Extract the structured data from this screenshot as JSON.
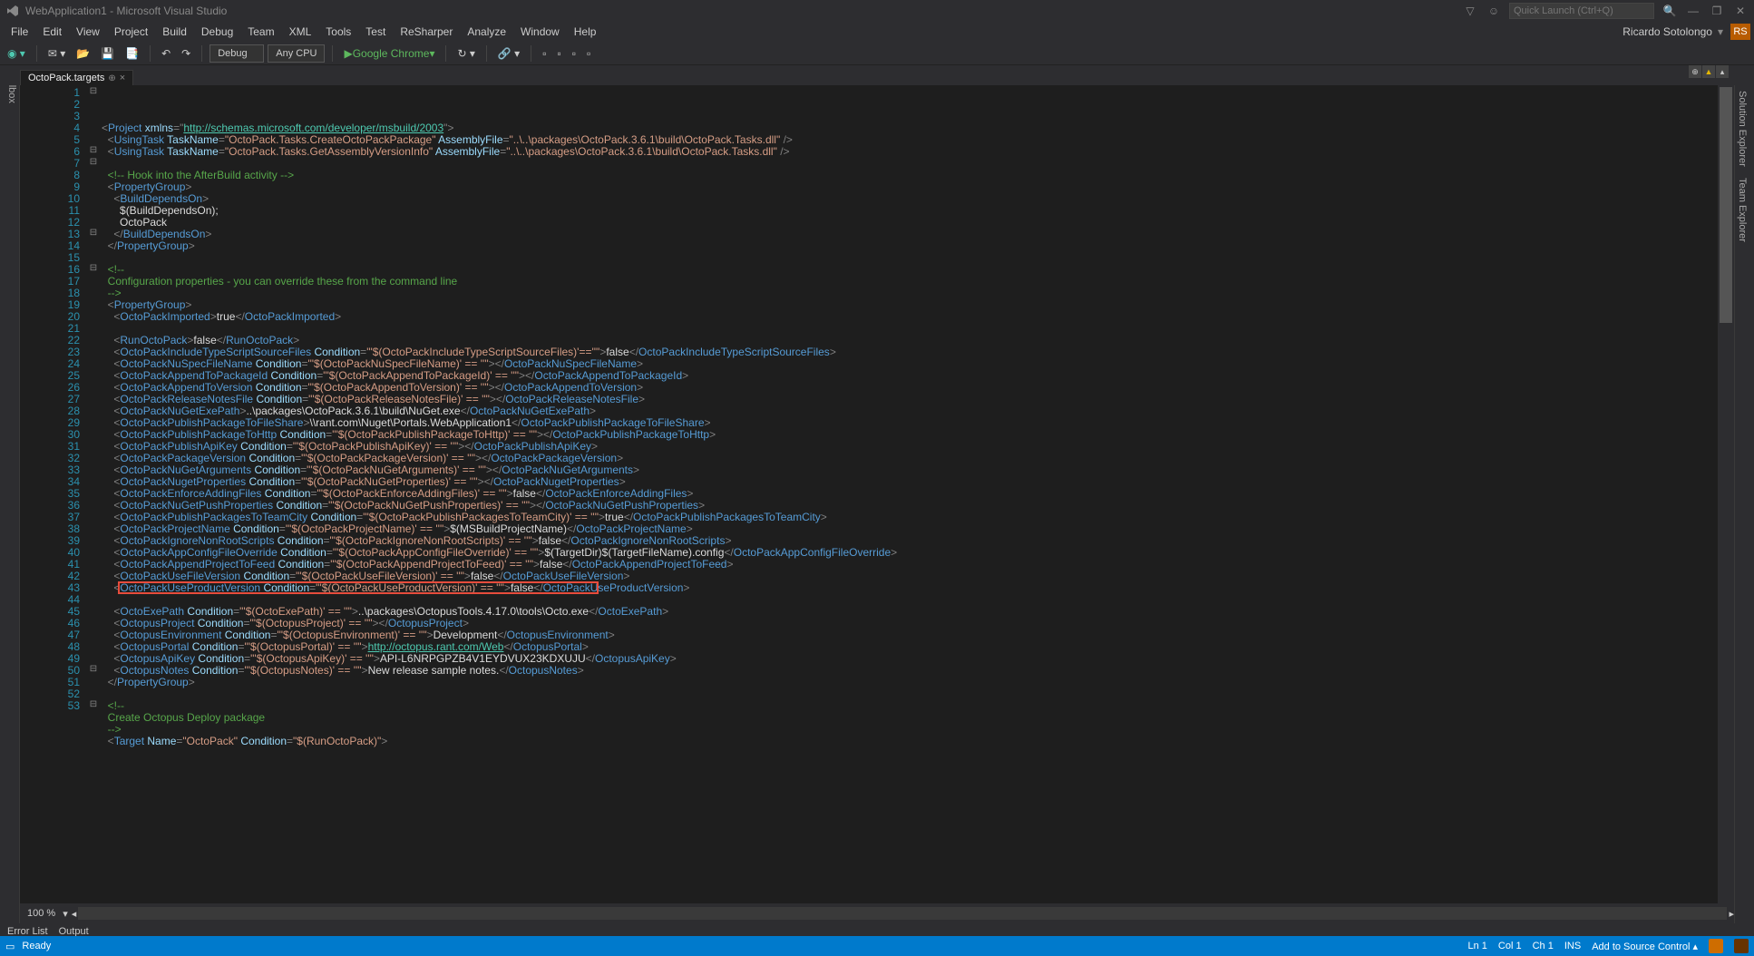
{
  "title": "WebApplication1 - Microsoft Visual Studio",
  "quick_launch_placeholder": "Quick Launch (Ctrl+Q)",
  "menu": [
    "File",
    "Edit",
    "View",
    "Project",
    "Build",
    "Debug",
    "Team",
    "XML",
    "Tools",
    "Test",
    "ReSharper",
    "Analyze",
    "Window",
    "Help"
  ],
  "user_name": "Ricardo Sotolongo",
  "user_initials": "RS",
  "toolbar": {
    "config": "Debug",
    "platform": "Any CPU",
    "run_label": "Google Chrome"
  },
  "left_rail": "Toolbox",
  "right_rails": [
    "Solution Explorer",
    "Team Explorer"
  ],
  "tab": {
    "label": "OctoPack.targets",
    "pin": "⊕",
    "close": "×"
  },
  "zoom": "100 %",
  "output_tabs": [
    "Error List",
    "Output"
  ],
  "status": {
    "ready": "Ready",
    "ln": "Ln 1",
    "col": "Col 1",
    "ch": "Ch 1",
    "ins": "INS",
    "src": "Add to Source Control"
  },
  "code_lines": [
    {
      "n": 1,
      "g": "⊟",
      "html": "<span class='c-punc'>&lt;</span><span class='c-elem'>Project</span> <span class='c-attr'>xmlns</span><span class='c-punc'>=&quot;</span><span class='c-link'>http://schemas.microsoft.com/developer/msbuild/2003</span><span class='c-punc'>&quot;&gt;</span>"
    },
    {
      "n": 2,
      "g": "",
      "html": "  <span class='c-punc'>&lt;</span><span class='c-elem'>UsingTask</span> <span class='c-attr'>TaskName</span><span class='c-punc'>=</span><span class='c-str'>&quot;OctoPack.Tasks.CreateOctoPackPackage&quot;</span> <span class='c-attr'>AssemblyFile</span><span class='c-punc'>=</span><span class='c-str'>&quot;..\\..\\packages\\OctoPack.3.6.1\\build\\OctoPack.Tasks.dll&quot;</span> <span class='c-punc'>/&gt;</span>"
    },
    {
      "n": 3,
      "g": "",
      "html": "  <span class='c-punc'>&lt;</span><span class='c-elem'>UsingTask</span> <span class='c-attr'>TaskName</span><span class='c-punc'>=</span><span class='c-str'>&quot;OctoPack.Tasks.GetAssemblyVersionInfo&quot;</span> <span class='c-attr'>AssemblyFile</span><span class='c-punc'>=</span><span class='c-str'>&quot;..\\..\\packages\\OctoPack.3.6.1\\build\\OctoPack.Tasks.dll&quot;</span> <span class='c-punc'>/&gt;</span>"
    },
    {
      "n": 4,
      "g": "",
      "html": ""
    },
    {
      "n": 5,
      "g": "",
      "html": "  <span class='c-cmt'>&lt;!-- Hook into the AfterBuild activity --&gt;</span>"
    },
    {
      "n": 6,
      "g": "⊟",
      "html": "  <span class='c-punc'>&lt;</span><span class='c-elem'>PropertyGroup</span><span class='c-punc'>&gt;</span>"
    },
    {
      "n": 7,
      "g": "⊟",
      "html": "    <span class='c-punc'>&lt;</span><span class='c-elem'>BuildDependsOn</span><span class='c-punc'>&gt;</span>"
    },
    {
      "n": 8,
      "g": "",
      "html": "      <span class='c-txt'>$(BuildDependsOn);</span>"
    },
    {
      "n": 9,
      "g": "",
      "html": "      <span class='c-txt'>OctoPack</span>"
    },
    {
      "n": 10,
      "g": "",
      "html": "    <span class='c-punc'>&lt;/</span><span class='c-elem'>BuildDependsOn</span><span class='c-punc'>&gt;</span>"
    },
    {
      "n": 11,
      "g": "",
      "html": "  <span class='c-punc'>&lt;/</span><span class='c-elem'>PropertyGroup</span><span class='c-punc'>&gt;</span>"
    },
    {
      "n": 12,
      "g": "",
      "html": ""
    },
    {
      "n": 13,
      "g": "⊟",
      "html": "  <span class='c-cmt'>&lt;!--</span>"
    },
    {
      "n": 14,
      "g": "",
      "html": "  <span class='c-cmt'>Configuration properties - you can override these from the command line</span>"
    },
    {
      "n": 15,
      "g": "",
      "html": "  <span class='c-cmt'>--&gt;</span>"
    },
    {
      "n": 16,
      "g": "⊟",
      "html": "  <span class='c-punc'>&lt;</span><span class='c-elem'>PropertyGroup</span><span class='c-punc'>&gt;</span>"
    },
    {
      "n": 17,
      "g": "",
      "html": "    <span class='c-punc'>&lt;</span><span class='c-elem'>OctoPackImported</span><span class='c-punc'>&gt;</span><span class='c-txt'>true</span><span class='c-punc'>&lt;/</span><span class='c-elem'>OctoPackImported</span><span class='c-punc'>&gt;</span>"
    },
    {
      "n": 18,
      "g": "",
      "html": ""
    },
    {
      "n": 19,
      "g": "",
      "html": "    <span class='c-punc'>&lt;</span><span class='c-elem'>RunOctoPack</span><span class='c-punc'>&gt;</span><span class='c-txt'>false</span><span class='c-punc'>&lt;/</span><span class='c-elem'>RunOctoPack</span><span class='c-punc'>&gt;</span>"
    },
    {
      "n": 20,
      "g": "",
      "html": "    <span class='c-punc'>&lt;</span><span class='c-elem'>OctoPackIncludeTypeScriptSourceFiles</span> <span class='c-attr'>Condition</span><span class='c-punc'>=</span><span class='c-str'>&quot;'$(OctoPackIncludeTypeScriptSourceFiles)'==''&quot;</span><span class='c-punc'>&gt;</span><span class='c-txt'>false</span><span class='c-punc'>&lt;/</span><span class='c-elem'>OctoPackIncludeTypeScriptSourceFiles</span><span class='c-punc'>&gt;</span>"
    },
    {
      "n": 21,
      "g": "",
      "html": "    <span class='c-punc'>&lt;</span><span class='c-elem'>OctoPackNuSpecFileName</span> <span class='c-attr'>Condition</span><span class='c-punc'>=</span><span class='c-str'>&quot;'$(OctoPackNuSpecFileName)' == ''&quot;</span><span class='c-punc'>&gt;&lt;/</span><span class='c-elem'>OctoPackNuSpecFileName</span><span class='c-punc'>&gt;</span>"
    },
    {
      "n": 22,
      "g": "",
      "html": "    <span class='c-punc'>&lt;</span><span class='c-elem'>OctoPackAppendToPackageId</span> <span class='c-attr'>Condition</span><span class='c-punc'>=</span><span class='c-str'>&quot;'$(OctoPackAppendToPackageId)' == ''&quot;</span><span class='c-punc'>&gt;&lt;/</span><span class='c-elem'>OctoPackAppendToPackageId</span><span class='c-punc'>&gt;</span>"
    },
    {
      "n": 23,
      "g": "",
      "html": "    <span class='c-punc'>&lt;</span><span class='c-elem'>OctoPackAppendToVersion</span> <span class='c-attr'>Condition</span><span class='c-punc'>=</span><span class='c-str'>&quot;'$(OctoPackAppendToVersion)' == ''&quot;</span><span class='c-punc'>&gt;&lt;/</span><span class='c-elem'>OctoPackAppendToVersion</span><span class='c-punc'>&gt;</span>"
    },
    {
      "n": 24,
      "g": "",
      "html": "    <span class='c-punc'>&lt;</span><span class='c-elem'>OctoPackReleaseNotesFile</span> <span class='c-attr'>Condition</span><span class='c-punc'>=</span><span class='c-str'>&quot;'$(OctoPackReleaseNotesFile)' == ''&quot;</span><span class='c-punc'>&gt;&lt;/</span><span class='c-elem'>OctoPackReleaseNotesFile</span><span class='c-punc'>&gt;</span>"
    },
    {
      "n": 25,
      "g": "",
      "html": "    <span class='c-punc'>&lt;</span><span class='c-elem'>OctoPackNuGetExePath</span><span class='c-punc'>&gt;</span><span class='c-txt'>..\\packages\\OctoPack.3.6.1\\build\\NuGet.exe</span><span class='c-punc'>&lt;/</span><span class='c-elem'>OctoPackNuGetExePath</span><span class='c-punc'>&gt;</span>"
    },
    {
      "n": 26,
      "g": "",
      "html": "    <span class='c-punc'>&lt;</span><span class='c-elem'>OctoPackPublishPackageToFileShare</span><span class='c-punc'>&gt;</span><span class='c-txt'>\\\\rant.com\\Nuget\\Portals.WebApplication1</span><span class='c-punc'>&lt;/</span><span class='c-elem'>OctoPackPublishPackageToFileShare</span><span class='c-punc'>&gt;</span>"
    },
    {
      "n": 27,
      "g": "",
      "html": "    <span class='c-punc'>&lt;</span><span class='c-elem'>OctoPackPublishPackageToHttp</span> <span class='c-attr'>Condition</span><span class='c-punc'>=</span><span class='c-str'>&quot;'$(OctoPackPublishPackageToHttp)' == ''&quot;</span><span class='c-punc'>&gt;&lt;/</span><span class='c-elem'>OctoPackPublishPackageToHttp</span><span class='c-punc'>&gt;</span>"
    },
    {
      "n": 28,
      "g": "",
      "html": "    <span class='c-punc'>&lt;</span><span class='c-elem'>OctoPackPublishApiKey</span> <span class='c-attr'>Condition</span><span class='c-punc'>=</span><span class='c-str'>&quot;'$(OctoPackPublishApiKey)' == ''&quot;</span><span class='c-punc'>&gt;&lt;/</span><span class='c-elem'>OctoPackPublishApiKey</span><span class='c-punc'>&gt;</span>"
    },
    {
      "n": 29,
      "g": "",
      "html": "    <span class='c-punc'>&lt;</span><span class='c-elem'>OctoPackPackageVersion</span> <span class='c-attr'>Condition</span><span class='c-punc'>=</span><span class='c-str'>&quot;'$(OctoPackPackageVersion)' == ''&quot;</span><span class='c-punc'>&gt;&lt;/</span><span class='c-elem'>OctoPackPackageVersion</span><span class='c-punc'>&gt;</span>"
    },
    {
      "n": 30,
      "g": "",
      "html": "    <span class='c-punc'>&lt;</span><span class='c-elem'>OctoPackNuGetArguments</span> <span class='c-attr'>Condition</span><span class='c-punc'>=</span><span class='c-str'>&quot;'$(OctoPackNuGetArguments)' == ''&quot;</span><span class='c-punc'>&gt;&lt;/</span><span class='c-elem'>OctoPackNuGetArguments</span><span class='c-punc'>&gt;</span>"
    },
    {
      "n": 31,
      "g": "",
      "html": "    <span class='c-punc'>&lt;</span><span class='c-elem'>OctoPackNugetProperties</span> <span class='c-attr'>Condition</span><span class='c-punc'>=</span><span class='c-str'>&quot;'$(OctoPackNuGetProperties)' == ''&quot;</span><span class='c-punc'>&gt;&lt;/</span><span class='c-elem'>OctoPackNugetProperties</span><span class='c-punc'>&gt;</span>"
    },
    {
      "n": 32,
      "g": "",
      "html": "    <span class='c-punc'>&lt;</span><span class='c-elem'>OctoPackEnforceAddingFiles</span> <span class='c-attr'>Condition</span><span class='c-punc'>=</span><span class='c-str'>&quot;'$(OctoPackEnforceAddingFiles)' == ''&quot;</span><span class='c-punc'>&gt;</span><span class='c-txt'>false</span><span class='c-punc'>&lt;/</span><span class='c-elem'>OctoPackEnforceAddingFiles</span><span class='c-punc'>&gt;</span>"
    },
    {
      "n": 33,
      "g": "",
      "html": "    <span class='c-punc'>&lt;</span><span class='c-elem'>OctoPackNuGetPushProperties</span> <span class='c-attr'>Condition</span><span class='c-punc'>=</span><span class='c-str'>&quot;'$(OctoPackNuGetPushProperties)' == ''&quot;</span><span class='c-punc'>&gt;&lt;/</span><span class='c-elem'>OctoPackNuGetPushProperties</span><span class='c-punc'>&gt;</span>"
    },
    {
      "n": 34,
      "g": "",
      "html": "    <span class='c-punc'>&lt;</span><span class='c-elem'>OctoPackPublishPackagesToTeamCity</span> <span class='c-attr'>Condition</span><span class='c-punc'>=</span><span class='c-str'>&quot;'$(OctoPackPublishPackagesToTeamCity)' == ''&quot;</span><span class='c-punc'>&gt;</span><span class='c-txt'>true</span><span class='c-punc'>&lt;/</span><span class='c-elem'>OctoPackPublishPackagesToTeamCity</span><span class='c-punc'>&gt;</span>"
    },
    {
      "n": 35,
      "g": "",
      "html": "    <span class='c-punc'>&lt;</span><span class='c-elem'>OctoPackProjectName</span> <span class='c-attr'>Condition</span><span class='c-punc'>=</span><span class='c-str'>&quot;'$(OctoPackProjectName)' == ''&quot;</span><span class='c-punc'>&gt;</span><span class='c-txt'>$(MSBuildProjectName)</span><span class='c-punc'>&lt;/</span><span class='c-elem'>OctoPackProjectName</span><span class='c-punc'>&gt;</span>"
    },
    {
      "n": 36,
      "g": "",
      "html": "    <span class='c-punc'>&lt;</span><span class='c-elem'>OctoPackIgnoreNonRootScripts</span> <span class='c-attr'>Condition</span><span class='c-punc'>=</span><span class='c-str'>&quot;'$(OctoPackIgnoreNonRootScripts)' == ''&quot;</span><span class='c-punc'>&gt;</span><span class='c-txt'>false</span><span class='c-punc'>&lt;/</span><span class='c-elem'>OctoPackIgnoreNonRootScripts</span><span class='c-punc'>&gt;</span>"
    },
    {
      "n": 37,
      "g": "",
      "html": "    <span class='c-punc'>&lt;</span><span class='c-elem'>OctoPackAppConfigFileOverride</span> <span class='c-attr'>Condition</span><span class='c-punc'>=</span><span class='c-str'>&quot;'$(OctoPackAppConfigFileOverride)' == ''&quot;</span><span class='c-punc'>&gt;</span><span class='c-txt'>$(TargetDir)$(TargetFileName).config</span><span class='c-punc'>&lt;/</span><span class='c-elem'>OctoPackAppConfigFileOverride</span><span class='c-punc'>&gt;</span>"
    },
    {
      "n": 38,
      "g": "",
      "html": "    <span class='c-punc'>&lt;</span><span class='c-elem'>OctoPackAppendProjectToFeed</span> <span class='c-attr'>Condition</span><span class='c-punc'>=</span><span class='c-str'>&quot;'$(OctoPackAppendProjectToFeed)' == ''&quot;</span><span class='c-punc'>&gt;</span><span class='c-txt'>false</span><span class='c-punc'>&lt;/</span><span class='c-elem'>OctoPackAppendProjectToFeed</span><span class='c-punc'>&gt;</span>"
    },
    {
      "n": 39,
      "g": "",
      "html": "    <span class='c-punc'>&lt;</span><span class='c-elem'>OctoPackUseFileVersion</span> <span class='c-attr'>Condition</span><span class='c-punc'>=</span><span class='c-str'>&quot;'$(OctoPackUseFileVersion)' == ''&quot;</span><span class='c-punc'>&gt;</span><span class='c-txt'>false</span><span class='c-punc'>&lt;/</span><span class='c-elem'>OctoPackUseFileVersion</span><span class='c-punc'>&gt;</span>"
    },
    {
      "n": 40,
      "g": "",
      "html": "    <span class='c-punc'>&lt;</span><span class='c-elem'>OctoPackUseProductVersion</span> <span class='c-attr'>Condition</span><span class='c-punc'>=</span><span class='c-str'>&quot;'$(OctoPackUseProductVersion)' == ''&quot;</span><span class='c-punc'>&gt;</span><span class='c-txt'>false</span><span class='c-punc'>&lt;/</span><span class='c-elem'>OctoPackUseProductVersion</span><span class='c-punc'>&gt;</span>"
    },
    {
      "n": 41,
      "g": "",
      "html": ""
    },
    {
      "n": 42,
      "g": "",
      "html": "    <span class='c-punc'>&lt;</span><span class='c-elem'>OctoExePath</span> <span class='c-attr'>Condition</span><span class='c-punc'>=</span><span class='c-str'>&quot;'$(OctoExePath)' == ''&quot;</span><span class='c-punc'>&gt;</span><span class='c-txt'>..\\packages\\OctopusTools.4.17.0\\tools\\Octo.exe</span><span class='c-punc'>&lt;/</span><span class='c-elem'>OctoExePath</span><span class='c-punc'>&gt;</span>"
    },
    {
      "n": 43,
      "g": "",
      "html": "    <span class='c-punc'>&lt;</span><span class='c-elem'>OctopusProject</span> <span class='c-attr'>Condition</span><span class='c-punc'>=</span><span class='c-str'>&quot;'$(OctopusProject)' == ''&quot;</span><span class='c-punc'>&gt;&lt;/</span><span class='c-elem'>OctopusProject</span><span class='c-punc'>&gt;</span>"
    },
    {
      "n": 44,
      "g": "",
      "html": "    <span class='c-punc'>&lt;</span><span class='c-elem'>OctopusEnvironment</span> <span class='c-attr'>Condition</span><span class='c-punc'>=</span><span class='c-str'>&quot;'$(OctopusEnvironment)' == ''&quot;</span><span class='c-punc'>&gt;</span><span class='c-txt'>Development</span><span class='c-punc'>&lt;/</span><span class='c-elem'>OctopusEnvironment</span><span class='c-punc'>&gt;</span>"
    },
    {
      "n": 45,
      "g": "",
      "html": "    <span class='c-punc'>&lt;</span><span class='c-elem'>OctopusPortal</span> <span class='c-attr'>Condition</span><span class='c-punc'>=</span><span class='c-str'>&quot;'$(OctopusPortal)' == ''&quot;</span><span class='c-punc'>&gt;</span><span class='c-link'>http://octopus.rant.com/Web</span><span class='c-punc'>&lt;/</span><span class='c-elem'>OctopusPortal</span><span class='c-punc'>&gt;</span>"
    },
    {
      "n": 46,
      "g": "",
      "html": "    <span class='c-punc'>&lt;</span><span class='c-elem'>OctopusApiKey</span> <span class='c-attr'>Condition</span><span class='c-punc'>=</span><span class='c-str'>&quot;'$(OctopusApiKey)' == ''&quot;</span><span class='c-punc'>&gt;</span><span class='c-txt'>API-L6NRPGPZB4V1EYDVUX23KDXUJU</span><span class='c-punc'>&lt;/</span><span class='c-elem'>OctopusApiKey</span><span class='c-punc'>&gt;</span>"
    },
    {
      "n": 47,
      "g": "",
      "html": "    <span class='c-punc'>&lt;</span><span class='c-elem'>OctopusNotes</span> <span class='c-attr'>Condition</span><span class='c-punc'>=</span><span class='c-str'>&quot;'$(OctopusNotes)' == ''&quot;</span><span class='c-punc'>&gt;</span><span class='c-txt'>New release sample notes.</span><span class='c-punc'>&lt;/</span><span class='c-elem'>OctopusNotes</span><span class='c-punc'>&gt;</span>"
    },
    {
      "n": 48,
      "g": "",
      "html": "  <span class='c-punc'>&lt;/</span><span class='c-elem'>PropertyGroup</span><span class='c-punc'>&gt;</span>"
    },
    {
      "n": 49,
      "g": "",
      "html": ""
    },
    {
      "n": 50,
      "g": "⊟",
      "html": "  <span class='c-cmt'>&lt;!--</span>"
    },
    {
      "n": 51,
      "g": "",
      "html": "  <span class='c-cmt'>Create Octopus Deploy package</span>"
    },
    {
      "n": 52,
      "g": "",
      "html": "  <span class='c-cmt'>--&gt;</span>"
    },
    {
      "n": 53,
      "g": "⊟",
      "html": "  <span class='c-punc'>&lt;</span><span class='c-elem'>Target</span> <span class='c-attr'>Name</span><span class='c-punc'>=</span><span class='c-str'>&quot;OctoPack&quot;</span> <span class='c-attr'>Condition</span><span class='c-punc'>=</span><span class='c-str'>&quot;$(RunOctoPack)&quot;</span><span class='c-punc'>&gt;</span>"
    }
  ],
  "highlight_line": 43
}
